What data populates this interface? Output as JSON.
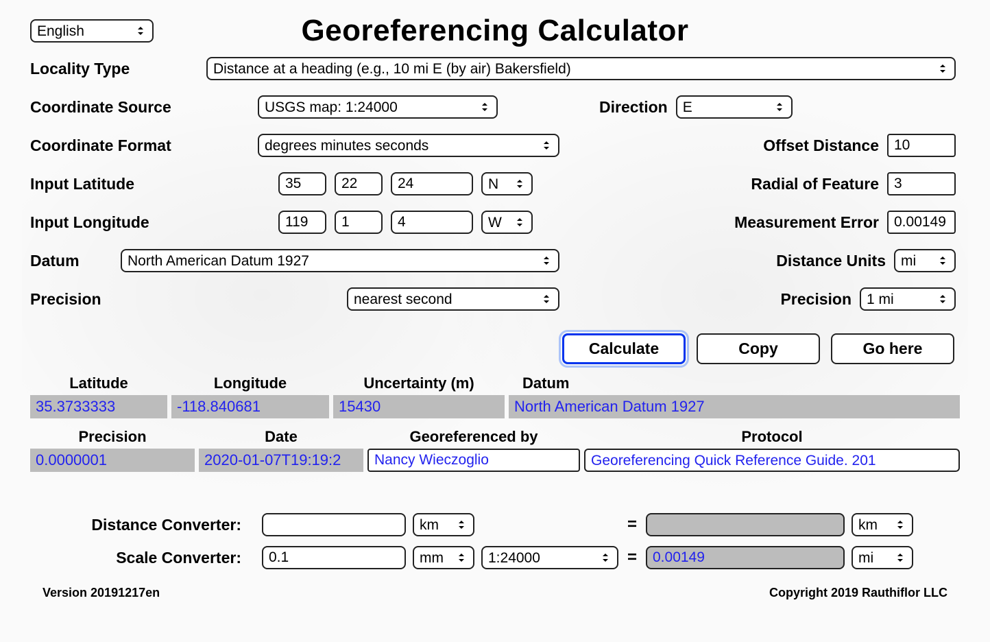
{
  "title": "Georeferencing Calculator",
  "language": "English",
  "labels": {
    "locality_type": "Locality Type",
    "coordinate_source": "Coordinate Source",
    "coordinate_format": "Coordinate Format",
    "input_latitude": "Input Latitude",
    "input_longitude": "Input Longitude",
    "datum": "Datum",
    "precision_left": "Precision",
    "direction": "Direction",
    "offset_distance": "Offset Distance",
    "radial_of_feature": "Radial of Feature",
    "measurement_error": "Measurement Error",
    "distance_units": "Distance Units",
    "precision_right": "Precision"
  },
  "inputs": {
    "locality_type": "Distance at a heading (e.g., 10 mi E (by air) Bakersfield)",
    "coordinate_source": "USGS map: 1:24000",
    "coordinate_format": "degrees minutes seconds",
    "lat_deg": "35",
    "lat_min": "22",
    "lat_sec": "24",
    "lat_hem": "N",
    "lon_deg": "119",
    "lon_min": "1",
    "lon_sec": "4",
    "lon_hem": "W",
    "datum": "North American Datum 1927",
    "precision_left": "nearest second",
    "direction": "E",
    "offset_distance": "10",
    "radial_of_feature": "3",
    "measurement_error": "0.00149",
    "distance_units": "mi",
    "precision_right": "1 mi"
  },
  "buttons": {
    "calculate": "Calculate",
    "copy": "Copy",
    "go_here": "Go here"
  },
  "results": {
    "headers": {
      "latitude": "Latitude",
      "longitude": "Longitude",
      "uncertainty": "Uncertainty (m)",
      "datum": "Datum",
      "precision": "Precision",
      "date": "Date",
      "georef_by": "Georeferenced by",
      "protocol": "Protocol"
    },
    "values": {
      "latitude": "35.3733333",
      "longitude": "-118.840681",
      "uncertainty": "15430",
      "datum": "North American Datum 1927",
      "precision": "0.0000001",
      "date": "2020-01-07T19:19:2",
      "georef_by": "Nancy Wieczoglio",
      "protocol": "Georeferencing Quick Reference Guide. 201"
    }
  },
  "converters": {
    "distance_label": "Distance Converter:",
    "scale_label": "Scale Converter:",
    "dist_in": "",
    "dist_in_unit": "km",
    "dist_out": "",
    "dist_out_unit": "km",
    "scale_in": "0.1",
    "scale_in_unit": "mm",
    "scale_map": "1:24000",
    "scale_out": "0.00149",
    "scale_out_unit": "mi",
    "eq": "="
  },
  "footer": {
    "version": "Version 20191217en",
    "copyright": "Copyright 2019 Rauthiflor LLC"
  }
}
